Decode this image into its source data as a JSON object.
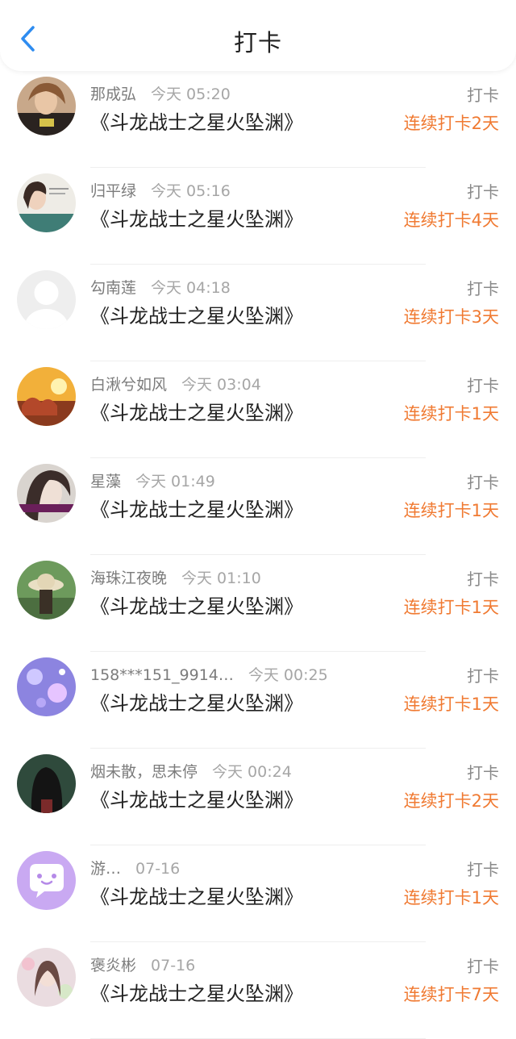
{
  "header": {
    "title": "打卡",
    "back_icon": "chevron-left-icon"
  },
  "colors": {
    "accent": "#2e8cf0",
    "streak": "#f07a32"
  },
  "rows": [
    {
      "name": "那成弘",
      "time": "今天 05:20",
      "book": "《斗龙战士之星火坠渊》",
      "checkin": "打卡",
      "streak": "连续打卡2天"
    },
    {
      "name": "归平绿",
      "time": "今天 05:16",
      "book": "《斗龙战士之星火坠渊》",
      "checkin": "打卡",
      "streak": "连续打卡4天"
    },
    {
      "name": "勾南莲",
      "time": "今天 04:18",
      "book": "《斗龙战士之星火坠渊》",
      "checkin": "打卡",
      "streak": "连续打卡3天"
    },
    {
      "name": "白湫兮如风",
      "time": "今天 03:04",
      "book": "《斗龙战士之星火坠渊》",
      "checkin": "打卡",
      "streak": "连续打卡1天"
    },
    {
      "name": "星藻",
      "time": "今天 01:49",
      "book": "《斗龙战士之星火坠渊》",
      "checkin": "打卡",
      "streak": "连续打卡1天"
    },
    {
      "name": "海珠江夜晚",
      "time": "今天 01:10",
      "book": "《斗龙战士之星火坠渊》",
      "checkin": "打卡",
      "streak": "连续打卡1天"
    },
    {
      "name": "158***151_9914…",
      "time": "今天 00:25",
      "book": "《斗龙战士之星火坠渊》",
      "checkin": "打卡",
      "streak": "连续打卡1天"
    },
    {
      "name": "烟未散，思未停",
      "time": "今天 00:24",
      "book": "《斗龙战士之星火坠渊》",
      "checkin": "打卡",
      "streak": "连续打卡2天"
    },
    {
      "name": "游…",
      "time": "07-16",
      "book": "《斗龙战士之星火坠渊》",
      "checkin": "打卡",
      "streak": "连续打卡1天"
    },
    {
      "name": "褒炎彬",
      "time": "07-16",
      "book": "《斗龙战士之星火坠渊》",
      "checkin": "打卡",
      "streak": "连续打卡7天"
    }
  ]
}
